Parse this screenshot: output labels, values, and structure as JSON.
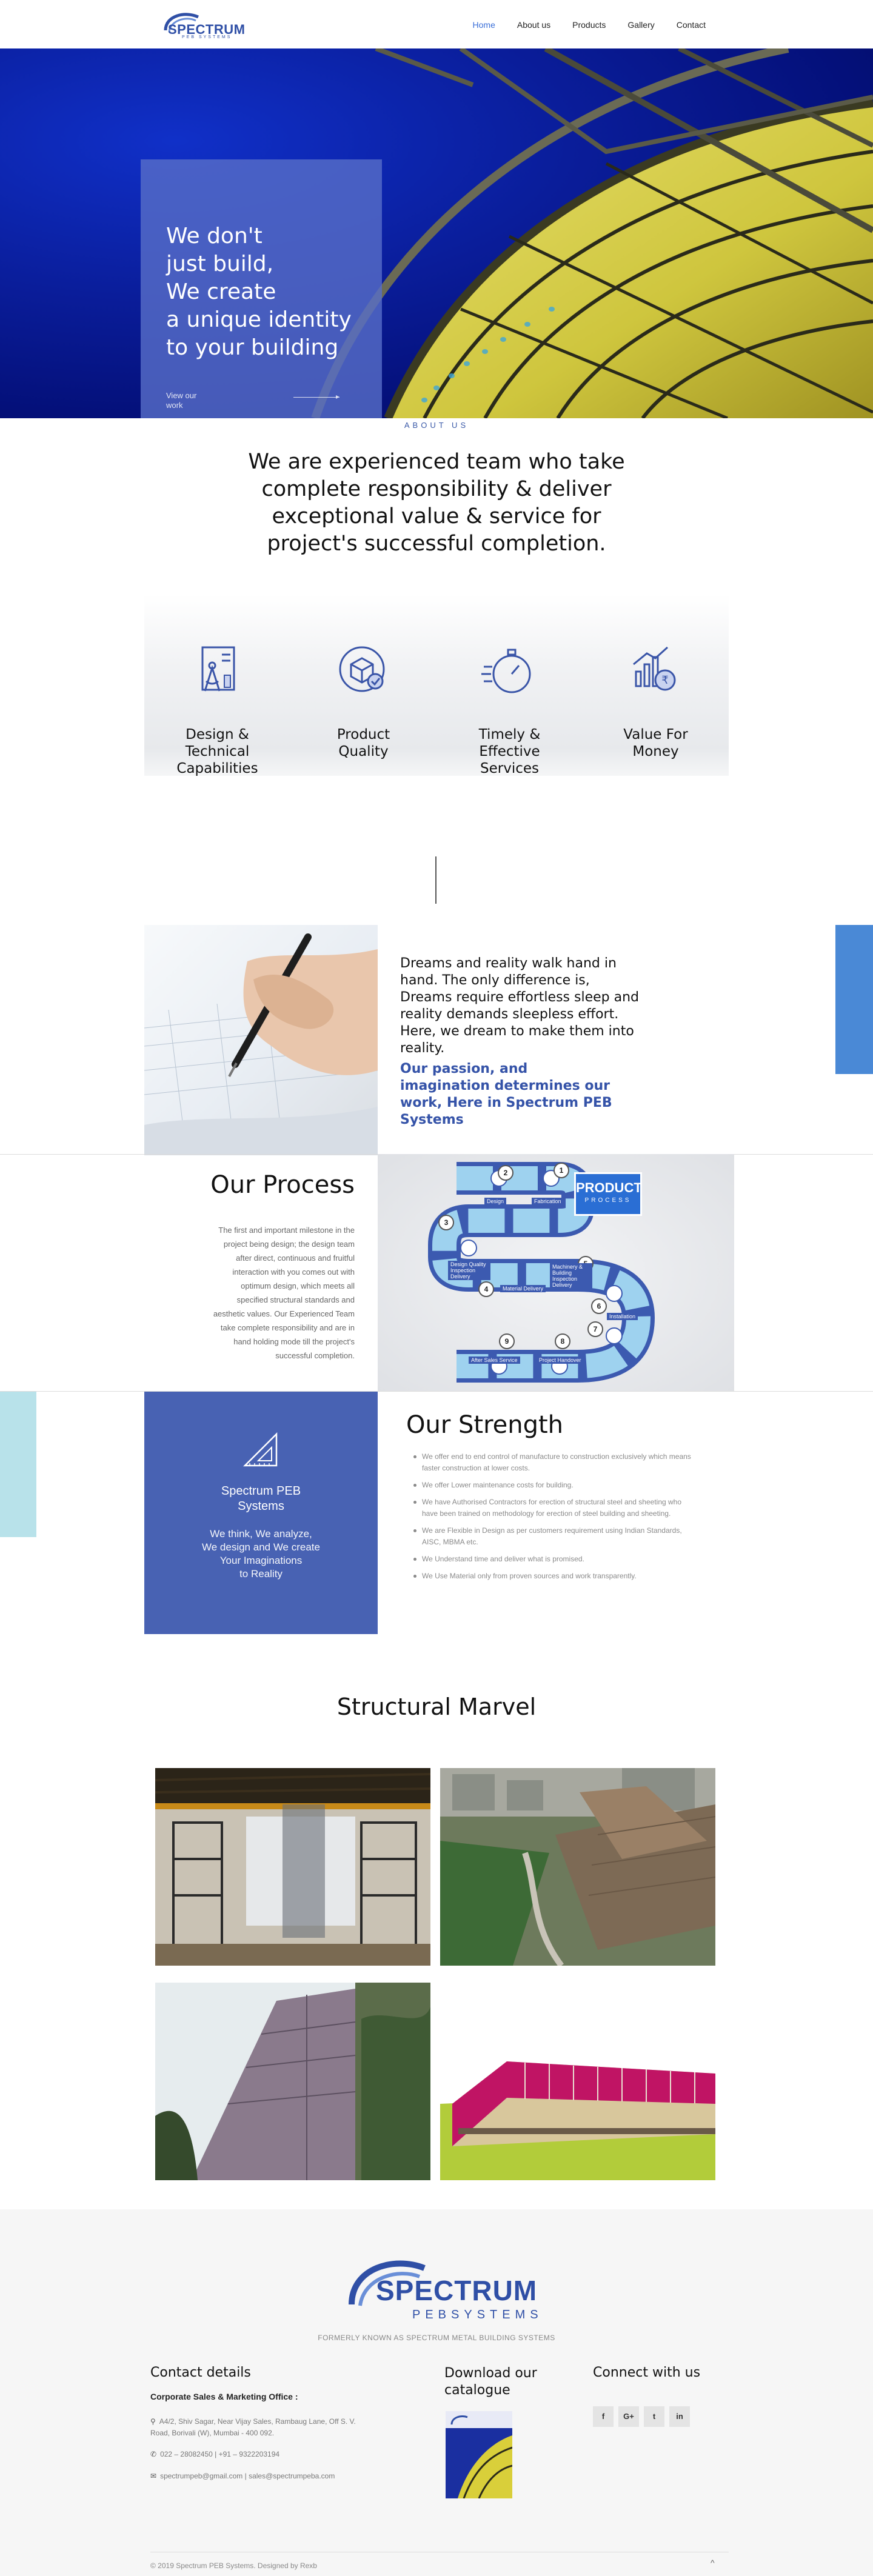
{
  "header": {
    "logo_text": "SPECTRUM",
    "logo_sub": "PEB SYSTEMS",
    "nav": [
      {
        "label": "Home",
        "active": true
      },
      {
        "label": "About us",
        "active": false
      },
      {
        "label": "Products",
        "active": false
      },
      {
        "label": "Gallery",
        "active": false
      },
      {
        "label": "Contact",
        "active": false
      }
    ]
  },
  "hero": {
    "title": "We don't\njust build,\nWe create\na unique identity\nto your building",
    "link": "View our work"
  },
  "about": {
    "label": "ABOUT US",
    "headline": "We are experienced team who take complete responsibility & deliver exceptional value & service for project's successful completion.",
    "features": [
      {
        "label": "Design &\nTechnical\nCapabilities",
        "icon": "design-document-icon"
      },
      {
        "label": "Product\nQuality",
        "icon": "quality-box-icon"
      },
      {
        "label": "Timely &\nEffective\nServices",
        "icon": "stopwatch-icon"
      },
      {
        "label": "Value For\nMoney",
        "icon": "rupee-growth-icon"
      }
    ]
  },
  "dream": {
    "text": "Dreams and reality walk hand in hand. The only difference is, Dreams require effortless sleep and reality demands sleepless effort. Here, we dream to make them into reality.",
    "quote": "Our passion, and imagination determines our work, Here in Spectrum PEB Systems"
  },
  "process": {
    "title": "Our Process",
    "body": "The first and important milestone in the project being design; the design team after direct, continuous and fruitful interaction with you comes out with optimum design, which meets all specified structural standards and aesthetic values. Our Experienced Team take complete responsibility and are in hand holding mode till the project's successful completion.",
    "diagram": {
      "badge_title": "PRODUCT",
      "badge_sub": "PROCESS",
      "steps": [
        "1",
        "2",
        "3",
        "4",
        "5",
        "6",
        "7",
        "8",
        "9"
      ],
      "labels": [
        "Design",
        "Fabrication",
        "Design Quality Inspection Delivery",
        "Material Delivery",
        "Machinery & Building Inspection Delivery",
        "Installation",
        "After Sales Service",
        "Project Handover"
      ]
    }
  },
  "strength": {
    "card_name": "Spectrum PEB\nSystems",
    "card_tagline": "We think, We analyze,\nWe design and We create\nYour Imaginations\nto Reality",
    "title": "Our Strength",
    "items": [
      "We offer end to end control of manufacture to construction exclusively which means faster construction at lower costs.",
      "We offer Lower maintenance costs for building.",
      "We have Authorised Contractors for erection of structural steel and sheeting who have been trained on methodology for erection of steel building and sheeting.",
      "We are Flexible in Design as per customers requirement using Indian Standards, AISC, MBMA etc.",
      "We Understand time and deliver what is promised.",
      "We Use Material only from proven sources and work transparently."
    ]
  },
  "gallery": {
    "title": "Structural Marvel"
  },
  "footer": {
    "logo_text": "SPECTRUM",
    "logo_sub": "PEBSYSTEMS",
    "former": "FORMERLY KNOWN AS SPECTRUM METAL BUILDING SYSTEMS",
    "contact_title": "Contact details",
    "office": "Corporate Sales & Marketing Office :",
    "address": "A4/2, Shiv Sagar, Near Vijay Sales, Rambaug Lane, Off S. V. Road, Borivali (W), Mumbai - 400 092.",
    "phone": "022 – 28082450 | +91 – 9322203194",
    "email": "spectrumpeb@gmail.com | sales@spectrumpeba.com",
    "catalogue_title": "Download our catalogue",
    "connect_title": "Connect with us",
    "socials": [
      "f",
      "G+",
      "t",
      "in"
    ],
    "copyright": "© 2019 Spectrum PEB Systems. Designed by Rexb",
    "up": "^"
  },
  "colors": {
    "brand": "#2f4fa6",
    "card_blue": "#4862b3",
    "accent_blue": "#4a89d6",
    "cyan": "#b8e2ea"
  }
}
